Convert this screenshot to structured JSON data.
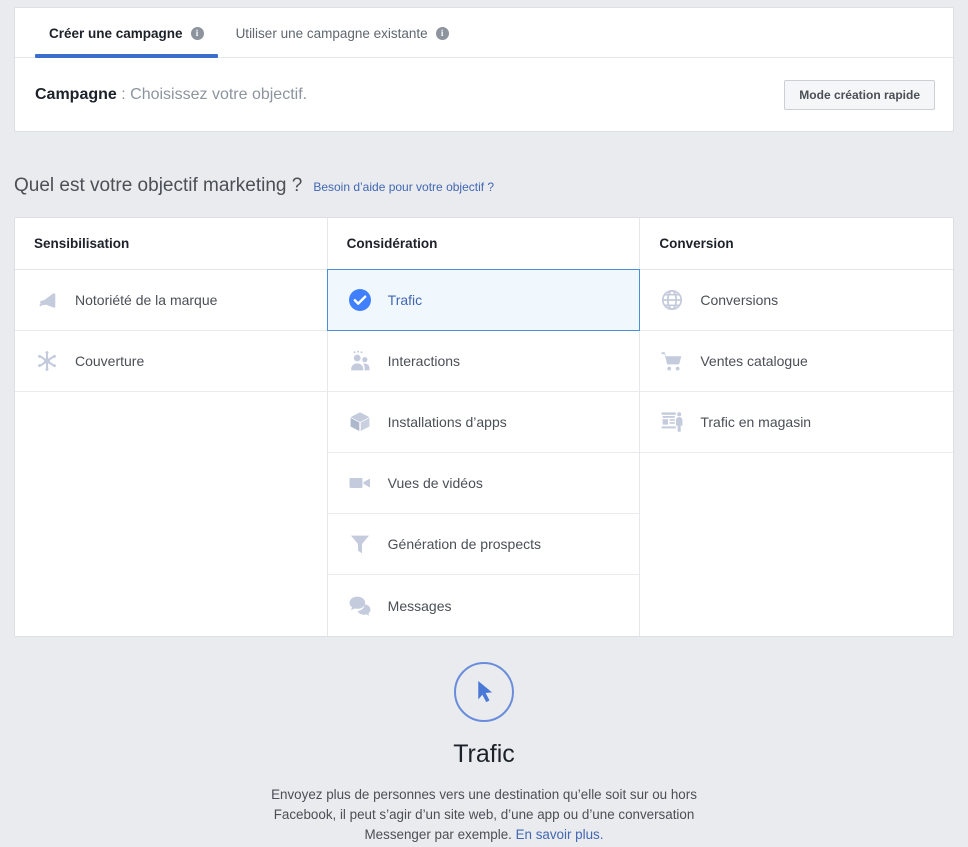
{
  "tabs": [
    {
      "label": "Créer une campagne",
      "info_icon": "info-icon",
      "active": true
    },
    {
      "label": "Utiliser une campagne existante",
      "info_icon": "info-icon",
      "active": false
    }
  ],
  "campaign_bar": {
    "label_bold": "Campagne",
    "label_rest": " : Choisissez votre objectif.",
    "quick_button": "Mode création rapide"
  },
  "objective_section": {
    "heading": "Quel est votre objectif marketing ?",
    "help_link": "Besoin d’aide pour votre objectif ?"
  },
  "columns": [
    {
      "header": "Sensibilisation",
      "items": [
        {
          "label": "Notoriété de la marque",
          "icon": "megaphone-icon",
          "selected": false
        },
        {
          "label": "Couverture",
          "icon": "reach-starburst-icon",
          "selected": false
        }
      ]
    },
    {
      "header": "Considération",
      "items": [
        {
          "label": "Trafic",
          "icon": "check-circle-icon",
          "selected": true
        },
        {
          "label": "Interactions",
          "icon": "people-icon",
          "selected": false
        },
        {
          "label": "Installations d’apps",
          "icon": "app-box-icon",
          "selected": false
        },
        {
          "label": "Vues de vidéos",
          "icon": "video-camera-icon",
          "selected": false
        },
        {
          "label": "Génération de prospects",
          "icon": "funnel-icon",
          "selected": false
        },
        {
          "label": "Messages",
          "icon": "chat-bubbles-icon",
          "selected": false
        }
      ]
    },
    {
      "header": "Conversion",
      "items": [
        {
          "label": "Conversions",
          "icon": "globe-icon",
          "selected": false
        },
        {
          "label": "Ventes catalogue",
          "icon": "shopping-cart-icon",
          "selected": false
        },
        {
          "label": "Trafic en magasin",
          "icon": "storefront-icon",
          "selected": false
        }
      ]
    }
  ],
  "detail": {
    "icon": "cursor-pointer-circle-icon",
    "title": "Trafic",
    "description": "Envoyez plus de personnes vers une destination qu’elle soit sur ou hors Facebook, il peut s’agir d’un site web, d’une app ou d’une conversation Messenger par exemple. ",
    "link": "En savoir plus."
  },
  "colors": {
    "accent_blue": "#3b6ecc",
    "link_blue": "#4267b2",
    "selected_bg": "#f0f7fd",
    "selected_border": "#4a90d9",
    "icon_gray": "#c3cbdc",
    "page_bg": "#e9ebee"
  }
}
